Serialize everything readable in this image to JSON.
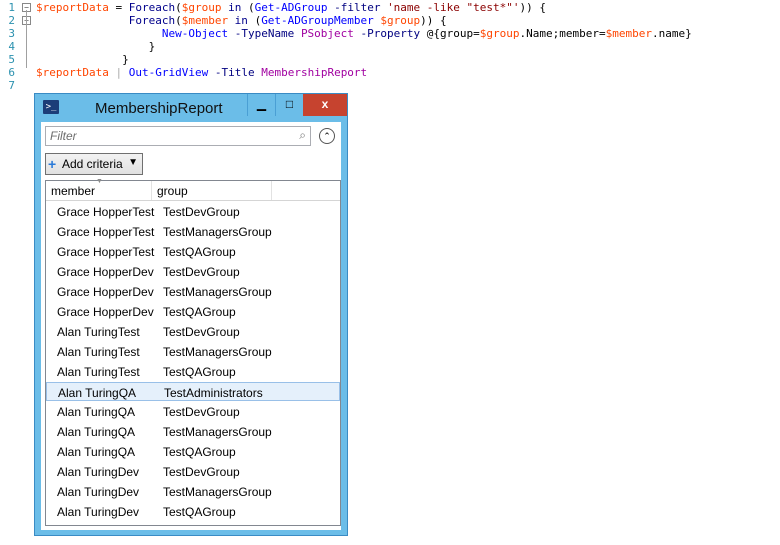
{
  "editor": {
    "lines": [
      {
        "n": "1",
        "fold": "−",
        "segs": [
          {
            "t": "$reportData",
            "c": "var"
          },
          {
            "t": " = ",
            "c": "pl"
          },
          {
            "t": "Foreach",
            "c": "kw"
          },
          {
            "t": "(",
            "c": "pl"
          },
          {
            "t": "$group",
            "c": "var"
          },
          {
            "t": " in ",
            "c": "kw"
          },
          {
            "t": "(",
            "c": "pl"
          },
          {
            "t": "Get-ADGroup",
            "c": "cmd"
          },
          {
            "t": " ",
            "c": "pl"
          },
          {
            "t": "-filter",
            "c": "prm"
          },
          {
            "t": " ",
            "c": "pl"
          },
          {
            "t": "'name -like \"test*\"'",
            "c": "str"
          },
          {
            "t": ")) {",
            "c": "pl"
          }
        ]
      },
      {
        "n": "2",
        "fold": "−",
        "segs": [
          {
            "t": "              ",
            "c": "pl"
          },
          {
            "t": "Foreach",
            "c": "kw"
          },
          {
            "t": "(",
            "c": "pl"
          },
          {
            "t": "$member",
            "c": "var"
          },
          {
            "t": " in ",
            "c": "kw"
          },
          {
            "t": "(",
            "c": "pl"
          },
          {
            "t": "Get-ADGroupMember",
            "c": "cmd"
          },
          {
            "t": " ",
            "c": "pl"
          },
          {
            "t": "$group",
            "c": "var"
          },
          {
            "t": ")) {",
            "c": "pl"
          }
        ]
      },
      {
        "n": "3",
        "fold": "",
        "segs": [
          {
            "t": "                   ",
            "c": "pl"
          },
          {
            "t": "New-Object",
            "c": "cmd"
          },
          {
            "t": " ",
            "c": "pl"
          },
          {
            "t": "-TypeName",
            "c": "prm"
          },
          {
            "t": " ",
            "c": "pl"
          },
          {
            "t": "PSobject",
            "c": "typ"
          },
          {
            "t": " ",
            "c": "pl"
          },
          {
            "t": "-Property",
            "c": "prm"
          },
          {
            "t": " @{group=",
            "c": "pl"
          },
          {
            "t": "$group",
            "c": "var"
          },
          {
            "t": ".Name;member=",
            "c": "pl"
          },
          {
            "t": "$member",
            "c": "var"
          },
          {
            "t": ".name}",
            "c": "pl"
          }
        ]
      },
      {
        "n": "4",
        "fold": "",
        "segs": [
          {
            "t": "                 }",
            "c": "pl"
          }
        ]
      },
      {
        "n": "5",
        "fold": "",
        "segs": [
          {
            "t": "             }",
            "c": "pl"
          }
        ]
      },
      {
        "n": "6",
        "fold": "",
        "segs": [
          {
            "t": "$reportData",
            "c": "var"
          },
          {
            "t": " | ",
            "c": "op"
          },
          {
            "t": "Out-GridView",
            "c": "cmd"
          },
          {
            "t": " ",
            "c": "pl"
          },
          {
            "t": "-Title",
            "c": "prm"
          },
          {
            "t": " ",
            "c": "pl"
          },
          {
            "t": "MembershipReport",
            "c": "typ"
          }
        ]
      },
      {
        "n": "7",
        "fold": "",
        "segs": []
      }
    ]
  },
  "window": {
    "title": "MembershipReport",
    "icon_glyph": ">_",
    "min_glyph": "▁",
    "max_glyph": "□",
    "close_glyph": "x",
    "filter_placeholder": "Filter",
    "search_glyph": "⌕",
    "collapse_glyph": "⌃",
    "add_criteria_plus": "+",
    "add_criteria_label": "Add criteria",
    "add_criteria_arrow": "▼",
    "sort_glyph": "▼",
    "columns": [
      "member",
      "group",
      ""
    ],
    "selected_row": 9,
    "rows": [
      {
        "member": "Grace HopperTest",
        "group": "TestDevGroup"
      },
      {
        "member": "Grace HopperTest",
        "group": "TestManagersGroup"
      },
      {
        "member": "Grace HopperTest",
        "group": "TestQAGroup"
      },
      {
        "member": "Grace HopperDev",
        "group": "TestDevGroup"
      },
      {
        "member": "Grace HopperDev",
        "group": "TestManagersGroup"
      },
      {
        "member": "Grace HopperDev",
        "group": "TestQAGroup"
      },
      {
        "member": "Alan TuringTest",
        "group": "TestDevGroup"
      },
      {
        "member": "Alan TuringTest",
        "group": "TestManagersGroup"
      },
      {
        "member": "Alan TuringTest",
        "group": "TestQAGroup"
      },
      {
        "member": "Alan TuringQA",
        "group": "TestAdministrators"
      },
      {
        "member": "Alan TuringQA",
        "group": "TestDevGroup"
      },
      {
        "member": "Alan TuringQA",
        "group": "TestManagersGroup"
      },
      {
        "member": "Alan TuringQA",
        "group": "TestQAGroup"
      },
      {
        "member": "Alan TuringDev",
        "group": "TestDevGroup"
      },
      {
        "member": "Alan TuringDev",
        "group": "TestManagersGroup"
      },
      {
        "member": "Alan TuringDev",
        "group": "TestQAGroup"
      }
    ],
    "colors": {
      "titlebar": "#6bbde8",
      "close": "#c6432f",
      "selection": "#e5f0fb"
    }
  }
}
